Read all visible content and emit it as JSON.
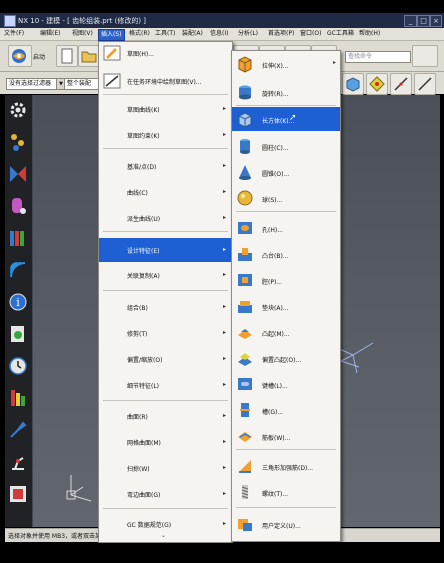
{
  "window": {
    "title": "NX 10 - 建模 - [ 齿轮组装.prt (修改的) ]",
    "minimize": "_",
    "maximize": "□",
    "close": "×"
  },
  "menubar": {
    "items": [
      "文件(F)",
      "编辑(E)",
      "视图(V)",
      "插入(S)",
      "格式(R)",
      "工具(T)",
      "装配(A)",
      "信息(I)",
      "分析(L)",
      "首选项(P)",
      "窗口(O)",
      "GC工具箱",
      "帮助(H)"
    ],
    "active_index": 3
  },
  "toolbar": {
    "start_label": "启动",
    "filter_combo": "没有选择过滤器",
    "assembly_combo": "整个装配",
    "search_placeholder": "查找命令"
  },
  "insert_menu": {
    "items": [
      {
        "label": "草图(H)...",
        "submenu": false
      },
      {
        "label": "在任务环境中绘制草图(V)...",
        "submenu": false
      },
      {
        "label": "草图曲线(K)",
        "submenu": true
      },
      {
        "label": "草图约束(K)",
        "submenu": true
      },
      {
        "label": "基准/点(D)",
        "submenu": true
      },
      {
        "label": "曲线(C)",
        "submenu": true
      },
      {
        "label": "派生曲线(U)",
        "submenu": true
      },
      {
        "label": "设计特征(E)",
        "submenu": true
      },
      {
        "label": "关联复制(A)",
        "submenu": true
      },
      {
        "label": "组合(B)",
        "submenu": true
      },
      {
        "label": "修剪(T)",
        "submenu": true
      },
      {
        "label": "偏置/缩放(O)",
        "submenu": true
      },
      {
        "label": "细节特征(L)",
        "submenu": true
      },
      {
        "label": "曲面(R)",
        "submenu": true
      },
      {
        "label": "网格曲面(M)",
        "submenu": true
      },
      {
        "label": "扫掠(W)",
        "submenu": true
      },
      {
        "label": "弯边曲面(G)",
        "submenu": true
      },
      {
        "label": "GC 数据规范(G)",
        "submenu": true
      }
    ],
    "active_index": 7
  },
  "design_feature_menu": {
    "items": [
      {
        "label": "拉伸(X)...",
        "icon": "extrude-icon"
      },
      {
        "label": "旋转(R)...",
        "icon": "revolve-icon"
      },
      {
        "label": "长方体(K)...",
        "icon": "block-icon"
      },
      {
        "label": "圆柱(C)...",
        "icon": "cylinder-icon"
      },
      {
        "label": "圆锥(O)...",
        "icon": "cone-icon"
      },
      {
        "label": "球(S)...",
        "icon": "sphere-icon"
      },
      {
        "label": "孔(H)...",
        "icon": "hole-icon"
      },
      {
        "label": "凸台(B)...",
        "icon": "boss-icon"
      },
      {
        "label": "腔(P)...",
        "icon": "pocket-icon"
      },
      {
        "label": "垫块(A)...",
        "icon": "pad-icon"
      },
      {
        "label": "凸起(M)...",
        "icon": "emboss-icon"
      },
      {
        "label": "偏置凸起(O)...",
        "icon": "offset-emboss-icon"
      },
      {
        "label": "键槽(L)...",
        "icon": "slot-icon"
      },
      {
        "label": "槽(G)...",
        "icon": "groove-icon"
      },
      {
        "label": "筋板(W)...",
        "icon": "rib-icon"
      },
      {
        "label": "三角形加强筋(D)...",
        "icon": "dart-icon"
      },
      {
        "label": "螺纹(T)...",
        "icon": "thread-icon"
      },
      {
        "label": "用户定义(U)...",
        "icon": "user-defined-icon"
      }
    ],
    "active_index": 2
  },
  "statusbar": {
    "text": "选择对象并使用 MB3，或者双击某一对象"
  },
  "colors": {
    "menu_highlight": "#1e5fd3",
    "menu_bg": "#f5f4f1",
    "graphics_bg": "#555960"
  }
}
